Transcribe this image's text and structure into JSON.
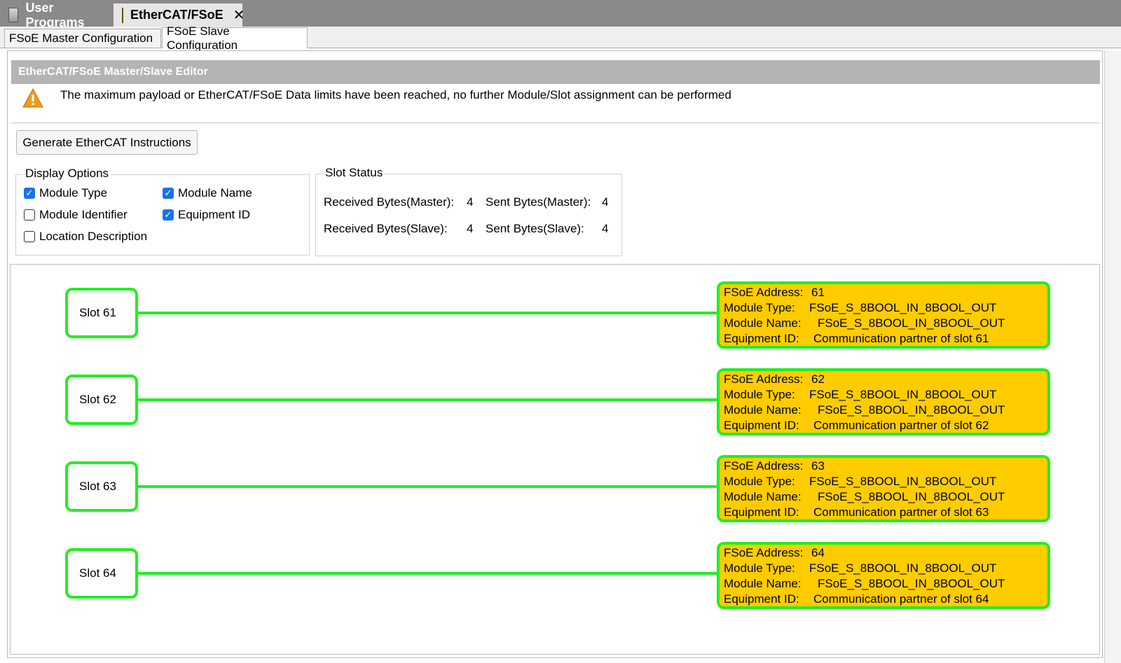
{
  "editor_tabs": [
    {
      "label": "User Programs",
      "icon": "program-icon"
    },
    {
      "label": "EtherCAT/FSoE",
      "icon": "ethercat-icon",
      "close": "✕"
    }
  ],
  "sub_tabs": [
    "FSoE Master Configuration",
    "FSoE Slave Configuration"
  ],
  "editor": {
    "title": "EtherCAT/FSoE Master/Slave Editor",
    "warning": "The maximum payload or EtherCAT/FSoE Data limits have been reached, no further Module/Slot assignment can be performed",
    "generate_button": "Generate EtherCAT Instructions"
  },
  "display_options": {
    "title": "Display Options",
    "items": [
      {
        "label": "Module Type",
        "checked": true
      },
      {
        "label": "Module Name",
        "checked": true
      },
      {
        "label": "Module Identifier",
        "checked": false
      },
      {
        "label": "Equipment ID",
        "checked": true
      },
      {
        "label": "Location Description",
        "checked": false
      }
    ]
  },
  "slot_status": {
    "title": "Slot Status",
    "received_master_label": "Received Bytes(Master):",
    "received_master_value": "4",
    "sent_master_label": "Sent Bytes(Master):",
    "sent_master_value": "4",
    "received_slave_label": "Received Bytes(Slave):",
    "received_slave_value": "4",
    "sent_slave_label": "Sent Bytes(Slave):",
    "sent_slave_value": "4"
  },
  "partner_labels": {
    "address": "FSoE Address:",
    "type": "Module Type:",
    "name": "Module Name:",
    "equipment": "Equipment ID:"
  },
  "slots": [
    {
      "label": "Slot 61",
      "address": "61",
      "type": "FSoE_S_8BOOL_IN_8BOOL_OUT",
      "name": "FSoE_S_8BOOL_IN_8BOOL_OUT",
      "equipment": "Communication partner of slot 61"
    },
    {
      "label": "Slot 62",
      "address": "62",
      "type": "FSoE_S_8BOOL_IN_8BOOL_OUT",
      "name": "FSoE_S_8BOOL_IN_8BOOL_OUT",
      "equipment": "Communication partner of slot 62"
    },
    {
      "label": "Slot 63",
      "address": "63",
      "type": "FSoE_S_8BOOL_IN_8BOOL_OUT",
      "name": "FSoE_S_8BOOL_IN_8BOOL_OUT",
      "equipment": "Communication partner of slot 63"
    },
    {
      "label": "Slot 64",
      "address": "64",
      "type": "FSoE_S_8BOOL_IN_8BOOL_OUT",
      "name": "FSoE_S_8BOOL_IN_8BOOL_OUT",
      "equipment": "Communication partner of slot 64"
    }
  ],
  "colors": {
    "link": "#22ee22",
    "partner_fill": "#ffcc00",
    "header": "#b4b4b4",
    "checkbox": "#1a73e8"
  }
}
